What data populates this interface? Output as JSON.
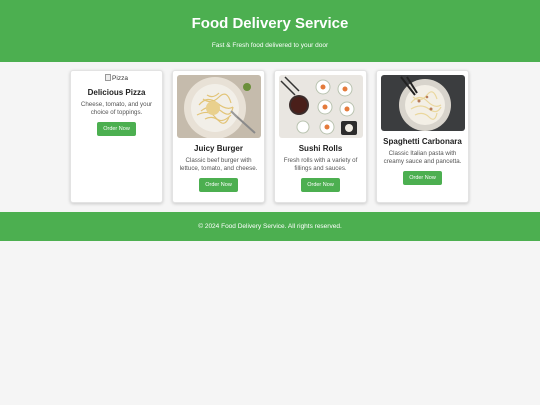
{
  "header": {
    "title": "Food Delivery Service",
    "subtitle": "Fast & Fresh food delivered to your door"
  },
  "items": [
    {
      "image_alt": "Pizza",
      "name": "Delicious Pizza",
      "description": "Cheese, tomato, and your choice of toppings.",
      "button": "Order Now"
    },
    {
      "name": "Juicy Burger",
      "description": "Classic beef burger with lettuce, tomato, and cheese.",
      "button": "Order Now"
    },
    {
      "name": "Sushi Rolls",
      "description": "Fresh rolls with a variety of fillings and sauces.",
      "button": "Order Now"
    },
    {
      "name": "Spaghetti Carbonara",
      "description": "Classic Italian pasta with creamy sauce and pancetta.",
      "button": "Order Now"
    }
  ],
  "footer": {
    "text": "© 2024 Food Delivery Service. All rights reserved."
  },
  "colors": {
    "accent": "#4caf50",
    "background": "#f5f5f5"
  }
}
